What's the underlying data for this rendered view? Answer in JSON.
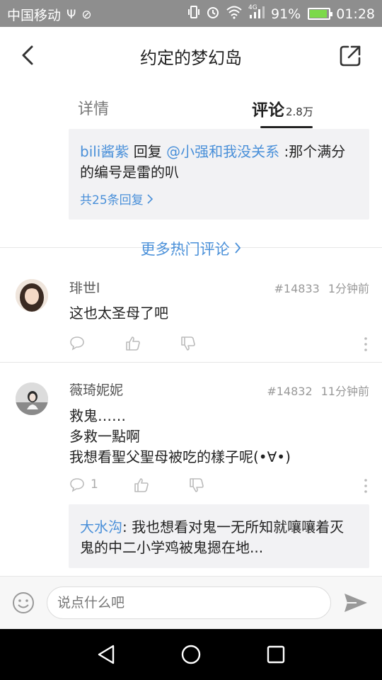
{
  "status_bar": {
    "carrier": "中国移动",
    "network": "4G",
    "battery_percent": "91%",
    "battery_level": 0.91,
    "time": "01:28"
  },
  "header": {
    "title": "约定的梦幻岛"
  },
  "tabs": {
    "detail_label": "详情",
    "comment_label": "评论",
    "comment_count": "2.8万"
  },
  "top_reply": {
    "author": "bili酱紫",
    "reply_word": " 回复 ",
    "target": "@小强和我没关系",
    "text": " :那个满分的编号是雷的叭",
    "more_replies": "共25条回复"
  },
  "more_hot_label": "更多热门评论",
  "comments": [
    {
      "username": "琲世l",
      "floor": "#14833",
      "time": "1分钟前",
      "text": "这也太圣母了吧",
      "reply_count": ""
    },
    {
      "username": "薇琦妮妮",
      "floor": "#14832",
      "time": "11分钟前",
      "lines": [
        "救鬼……",
        "多救一點啊",
        "我想看聖父聖母被吃的樣子呢(•∀•)"
      ],
      "reply_count": "1",
      "sub_reply": {
        "author": "大水沟",
        "text": ": 我也想看对鬼一无所知就嚷嚷着灭鬼的中二小学鸡被鬼摁在地..."
      }
    }
  ],
  "input": {
    "placeholder": "说点什么吧"
  },
  "colors": {
    "accent_blue": "#4a90d9",
    "status_bar": "#8e8e8e",
    "battery_green": "#7cd94a"
  }
}
